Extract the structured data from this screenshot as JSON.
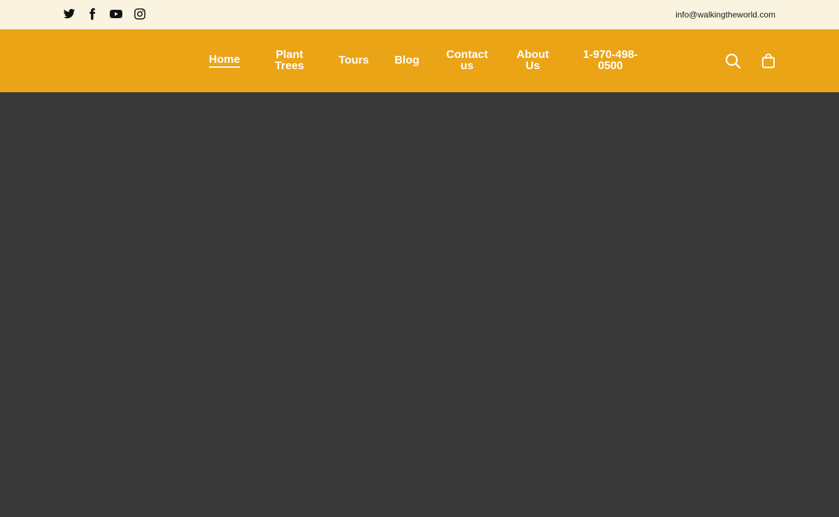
{
  "topbar": {
    "social": [
      {
        "icon": "twitter-icon"
      },
      {
        "icon": "facebook-icon"
      },
      {
        "icon": "youtube-icon"
      },
      {
        "icon": "instagram-icon"
      }
    ],
    "email": "info@walkingtheworld.com"
  },
  "nav": {
    "items": [
      {
        "label": "Home",
        "active": true
      },
      {
        "label": "Plant Trees"
      },
      {
        "label": "Tours"
      },
      {
        "label": "Blog"
      },
      {
        "label": "Contact us"
      },
      {
        "label": "About Us"
      },
      {
        "label": "1-970-498-0500"
      }
    ],
    "icons": [
      "search-icon",
      "shopping-bag-icon"
    ]
  },
  "colors": {
    "topbar_bg": "#faf3e0",
    "nav_bg": "#eaa416",
    "main_bg": "#393939",
    "nav_text": "#ffffff"
  }
}
